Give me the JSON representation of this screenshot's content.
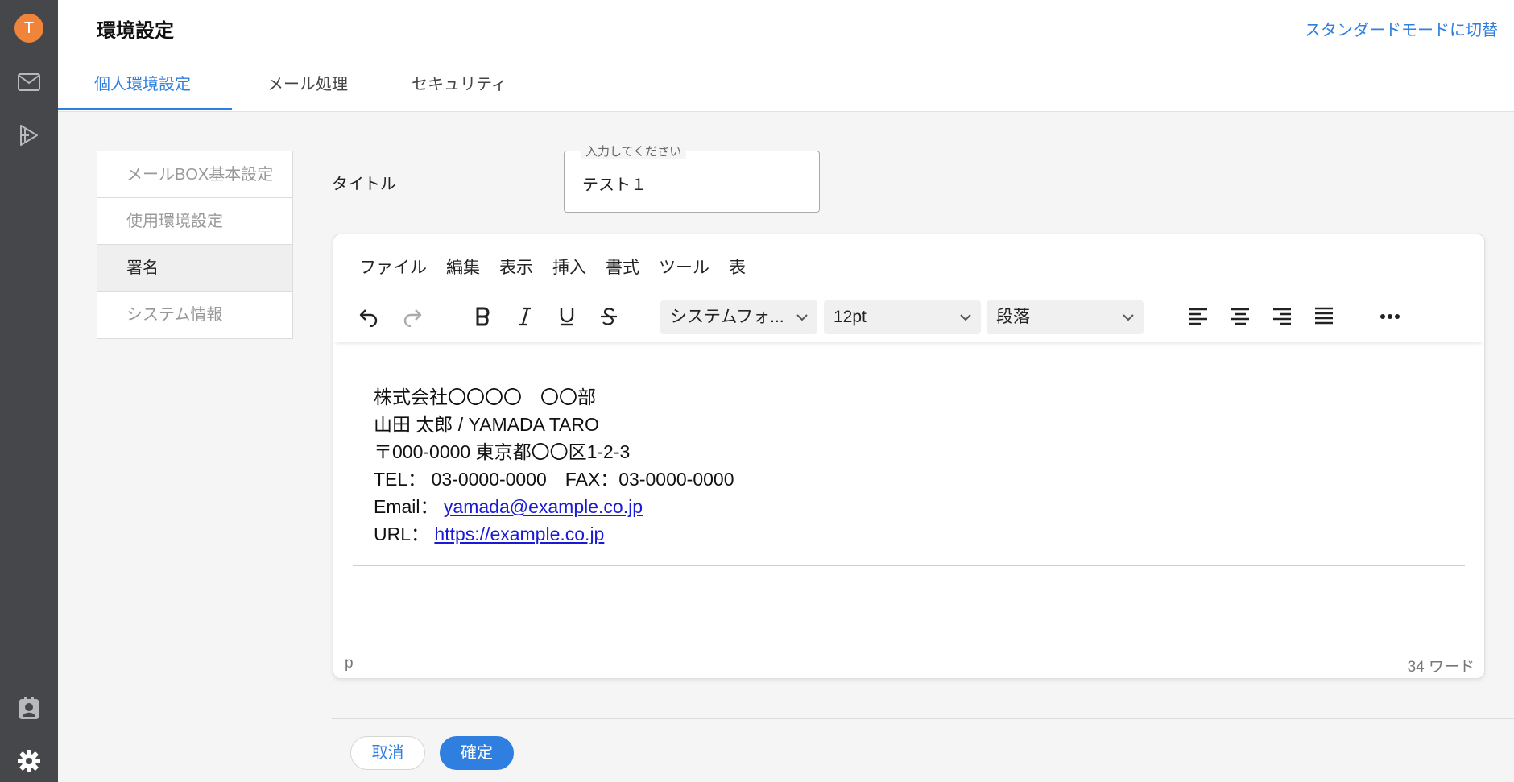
{
  "rail": {
    "avatar_letter": "T",
    "icons": [
      "mail-icon",
      "send-icon",
      "contact-badge-icon",
      "gear-icon"
    ]
  },
  "header": {
    "title": "環境設定",
    "mode_link": "スタンダードモードに切替",
    "tabs": [
      {
        "label": "個人環境設定",
        "active": true
      },
      {
        "label": "メール処理",
        "active": false
      },
      {
        "label": "セキュリティ",
        "active": false
      }
    ]
  },
  "side_menu": {
    "items": [
      {
        "label": "メールBOX基本設定",
        "active": false
      },
      {
        "label": "使用環境設定",
        "active": false
      },
      {
        "label": "署名",
        "active": true
      },
      {
        "label": "システム情報",
        "active": false
      }
    ]
  },
  "form": {
    "title_label": "タイトル",
    "title_placeholder": "入力してください",
    "title_value": "テスト１"
  },
  "editor": {
    "menubar": [
      "ファイル",
      "編集",
      "表示",
      "挿入",
      "書式",
      "ツール",
      "表"
    ],
    "font_family": "システムフォ...",
    "font_size": "12pt",
    "block_format": "段落",
    "signature": {
      "line1": "株式会社〇〇〇〇　〇〇部",
      "line2": "山田 太郎 / YAMADA TARO",
      "line3": "〒000-0000 東京都〇〇区1-2-3",
      "line4": "TEL： 03-0000-0000　FAX：03-0000-0000",
      "email_label": "Email：",
      "email_link": "yamada@example.co.jp",
      "url_label": "URL：",
      "url_link": "https://example.co.jp"
    },
    "status_path": "p",
    "word_count": "34 ワード"
  },
  "actions": {
    "cancel": "取消",
    "confirm": "確定"
  },
  "colors": {
    "accent": "#2f7fe0",
    "rail": "#46474a",
    "avatar": "#f0843a",
    "link": "#1a1ad6"
  }
}
